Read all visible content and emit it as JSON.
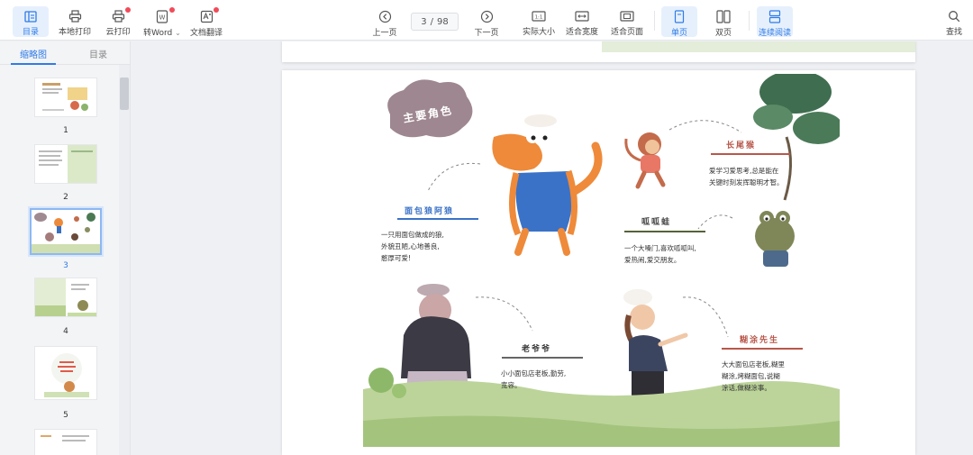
{
  "toolbar": {
    "toc": "目录",
    "local_print": "本地打印",
    "cloud_print": "云打印",
    "to_word": "转Word",
    "to_word_caret": "⌄",
    "translate": "文档翻译",
    "prev_page": "上一页",
    "page_current": "3",
    "page_separator": "/",
    "page_total": "98",
    "next_page": "下一页",
    "actual_size": "实际大小",
    "actual_size_glyph": "1:1",
    "fit_width": "适合宽度",
    "fit_page": "适合页面",
    "single_page": "单页",
    "double_page": "双页",
    "continuous": "连续阅读",
    "search": "查找",
    "word_glyph": "W",
    "accent": "#2f7be8",
    "badge": "#f04b5a"
  },
  "sidebar": {
    "tab_thumbnails": "缩略图",
    "tab_outline": "目录",
    "pages": [
      "1",
      "2",
      "3",
      "4",
      "5"
    ]
  },
  "page": {
    "title_cloud": "主要角色",
    "char1_name": "面包狼阿狼",
    "char1_desc_1": "一只用面包做成的狼,",
    "char1_desc_2": "外貌丑陋,心地善良,",
    "char1_desc_3": "憨厚可爱!",
    "char2_name": "长尾猴",
    "char2_desc_1": "爱学习爱思考,总是能在",
    "char2_desc_2": "关键时刻发挥聪明才智。",
    "char3_name": "呱呱蛙",
    "char3_desc_1": "一个大嗓门,喜欢呱呱叫,",
    "char3_desc_2": "爱热闹,爱交朋友。",
    "char4_name": "老爷爷",
    "char4_desc_1": "小小面包店老板,勤劳,",
    "char4_desc_2": "宽容。",
    "char5_name": "糊涂先生",
    "char5_desc_1": "大大面包店老板,糊里",
    "char5_desc_2": "糊涂,烤糊面包,说糊",
    "char5_desc_3": "涂话,做糊涂事。"
  }
}
